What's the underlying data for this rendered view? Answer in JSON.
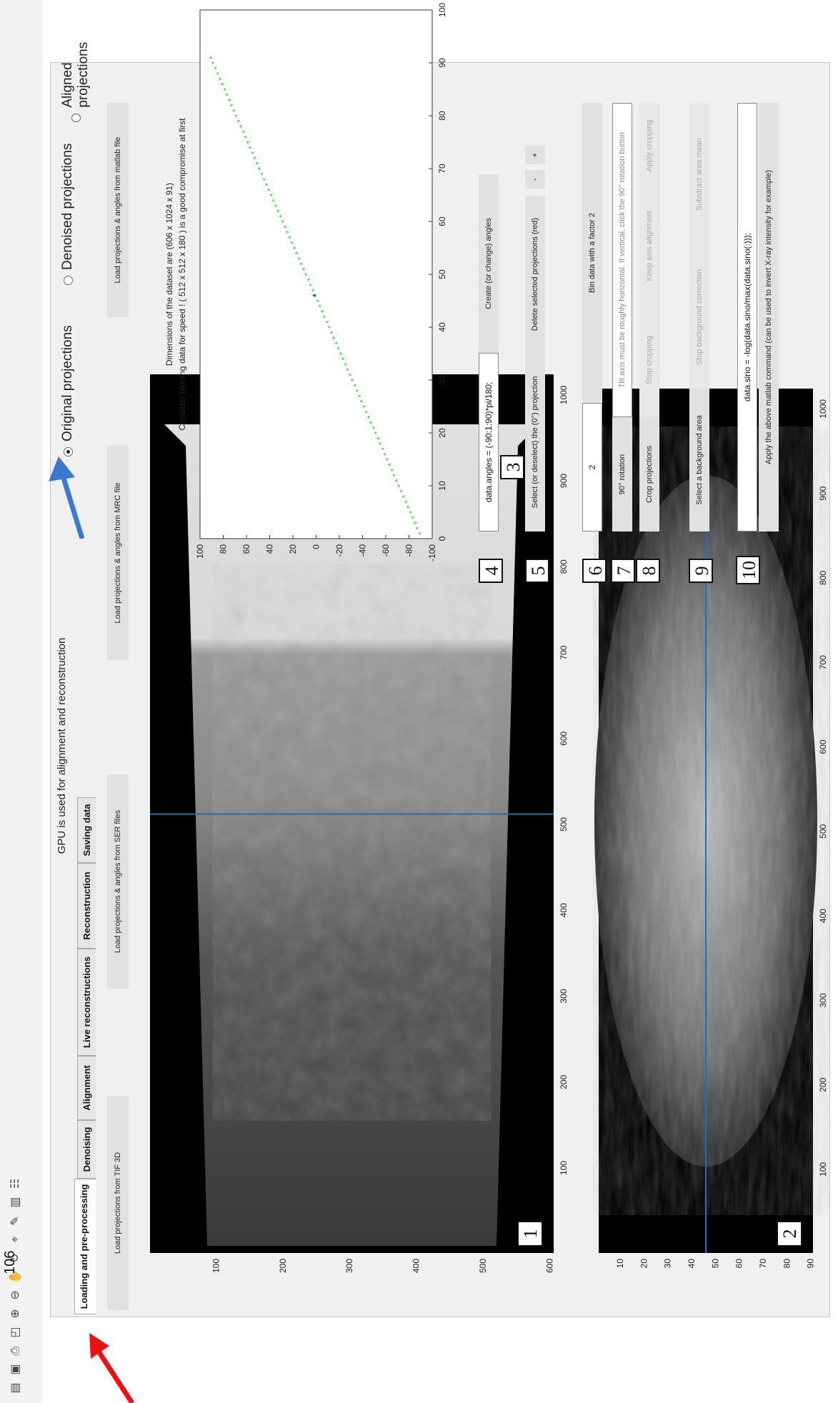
{
  "toolbar": {
    "icons": [
      "folder-icon",
      "save-icon",
      "print-icon",
      "dock-icon",
      "zoom-in-icon",
      "zoom-out-icon",
      "pan-icon",
      "rotate-icon",
      "data-cursor-icon",
      "brush-icon",
      "colorbar-icon",
      "legend-icon"
    ]
  },
  "status": {
    "gpu_text": "GPU is used for alignment and reconstruction"
  },
  "tabs": [
    {
      "label": "Loading and pre-processing",
      "active": true
    },
    {
      "label": "Denoising",
      "active": false
    },
    {
      "label": "Alignment",
      "active": false
    },
    {
      "label": "Live reconstructions",
      "active": false
    },
    {
      "label": "Reconstruction",
      "active": false
    },
    {
      "label": "Saving data",
      "active": false
    }
  ],
  "load_buttons": [
    "Load projections from TIF 3D",
    "Load projections & angles from SER files",
    "Load projections & angles from MRC file",
    "Load projections & angles from matlab file"
  ],
  "view_options": [
    {
      "label": "Original projections",
      "selected": true
    },
    {
      "label": "Denoised projections",
      "selected": false
    },
    {
      "label": "Aligned projections",
      "selected": false
    }
  ],
  "info": {
    "dimensions": "Dimensions of the dataset are (606 x 1024 x 91)",
    "binning_hint": "Consider binning data for speed ! ( 512 x 512 x 180 ) is a good compromise at first"
  },
  "angles": {
    "expression": "data.angles = (-90:1:90)*pi/180;",
    "create_button": "Create (or change) angles"
  },
  "selection": {
    "select_button": "Select (or deselect) the (0°) projection",
    "delete_button": "Delete selected projections (red)",
    "minus": "-",
    "plus": "+"
  },
  "binning": {
    "factor": "2",
    "bin_button": "Bin data with a factor 2"
  },
  "rotation": {
    "rotate_button": "90° rotation",
    "hint": "Tilt axis must be roughly horizontal. If vertical, click the 90° rotation button"
  },
  "cropping": {
    "crop_button": "Crop projections",
    "stop_crop": "Stop cropping",
    "keep_axis": "Keep axis alignment",
    "apply_crop": "Apply cropping"
  },
  "background": {
    "select_bg": "Select a background area",
    "stop_bg": "Stop background correction",
    "subtract": "Substract area mean"
  },
  "command": {
    "expression": "data.sino = -log(data.sino/max(data.sino(:)));",
    "apply_button": "Apply the above matlab command (can be used to invert X-ray intensity for example)"
  },
  "markers": [
    "1",
    "2",
    "3",
    "4",
    "5",
    "6",
    "7",
    "8",
    "9",
    "10"
  ],
  "page_number": "106",
  "projection_view": {
    "xticks": [
      100,
      200,
      300,
      400,
      500,
      600,
      700,
      800,
      900,
      1000
    ],
    "yticks": [
      100,
      200,
      300,
      400,
      500,
      600
    ],
    "xlim": [
      1,
      1024
    ],
    "ylim": [
      1,
      606
    ],
    "cursor_x": 512
  },
  "sinogram_view": {
    "xticks": [
      100,
      200,
      300,
      400,
      500,
      600,
      700,
      800,
      900,
      1000
    ],
    "yticks": [
      10,
      20,
      30,
      40,
      50,
      60,
      70,
      80,
      90
    ],
    "xlim": [
      1,
      1024
    ],
    "ylim": [
      1,
      91
    ],
    "cursor_y": 46
  },
  "chart_data": {
    "type": "scatter",
    "title": "",
    "xlabel": "",
    "ylabel": "",
    "xlim": [
      0,
      100
    ],
    "ylim": [
      -100,
      100
    ],
    "xticks": [
      0,
      10,
      20,
      30,
      40,
      50,
      60,
      70,
      80,
      90,
      100
    ],
    "yticks": [
      -100,
      -80,
      -60,
      -40,
      -20,
      0,
      20,
      40,
      60,
      80,
      100
    ],
    "series": [
      {
        "color": "#22cc22",
        "marker": "*",
        "x_start": 1,
        "x_end": 91,
        "y_start": -90,
        "y_end": 90
      }
    ],
    "highlight": {
      "x": 46,
      "y": 0,
      "color": "#0000cc"
    },
    "grid": false
  }
}
